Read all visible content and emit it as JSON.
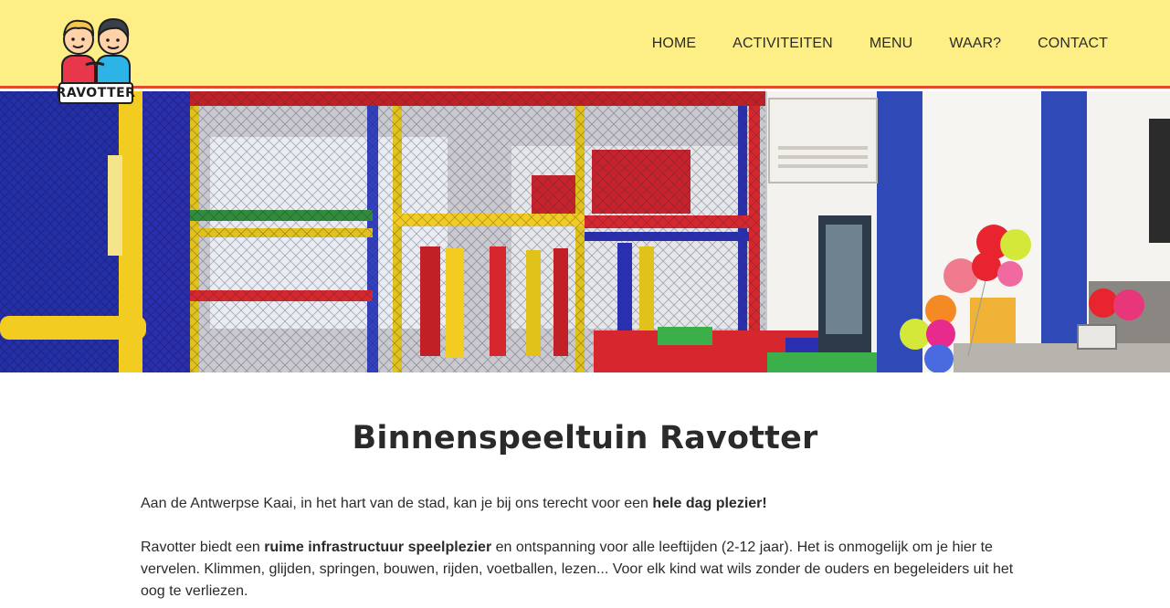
{
  "brand": {
    "name": "RAVOTTER"
  },
  "nav": {
    "items": [
      {
        "label": "HOME"
      },
      {
        "label": "ACTIVITEITEN"
      },
      {
        "label": "MENU"
      },
      {
        "label": "WAAR?"
      },
      {
        "label": "CONTACT"
      }
    ]
  },
  "main": {
    "title": "Binnenspeeltuin Ravotter",
    "p1": {
      "text1": "Aan de Antwerpse Kaai, in het hart van de stad, kan je bij ons terecht voor een ",
      "bold1": "hele dag plezier!"
    },
    "p2": {
      "text1": "Ravotter biedt een ",
      "bold1": "ruime infrastructuur speelplezier",
      "text2": " en ontspanning voor alle leeftijden (2-12 jaar). Het is onmogelijk om je hier te vervelen. Klimmen, glijden, springen, bouwen, rijden, voetballen, lezen... Voor elk kind wat wils zonder de ouders en begeleiders uit het oog te verliezen."
    }
  },
  "colors": {
    "header_bg": "#fdee86",
    "header_border": "#e24a2e",
    "text": "#2b2b2b"
  }
}
